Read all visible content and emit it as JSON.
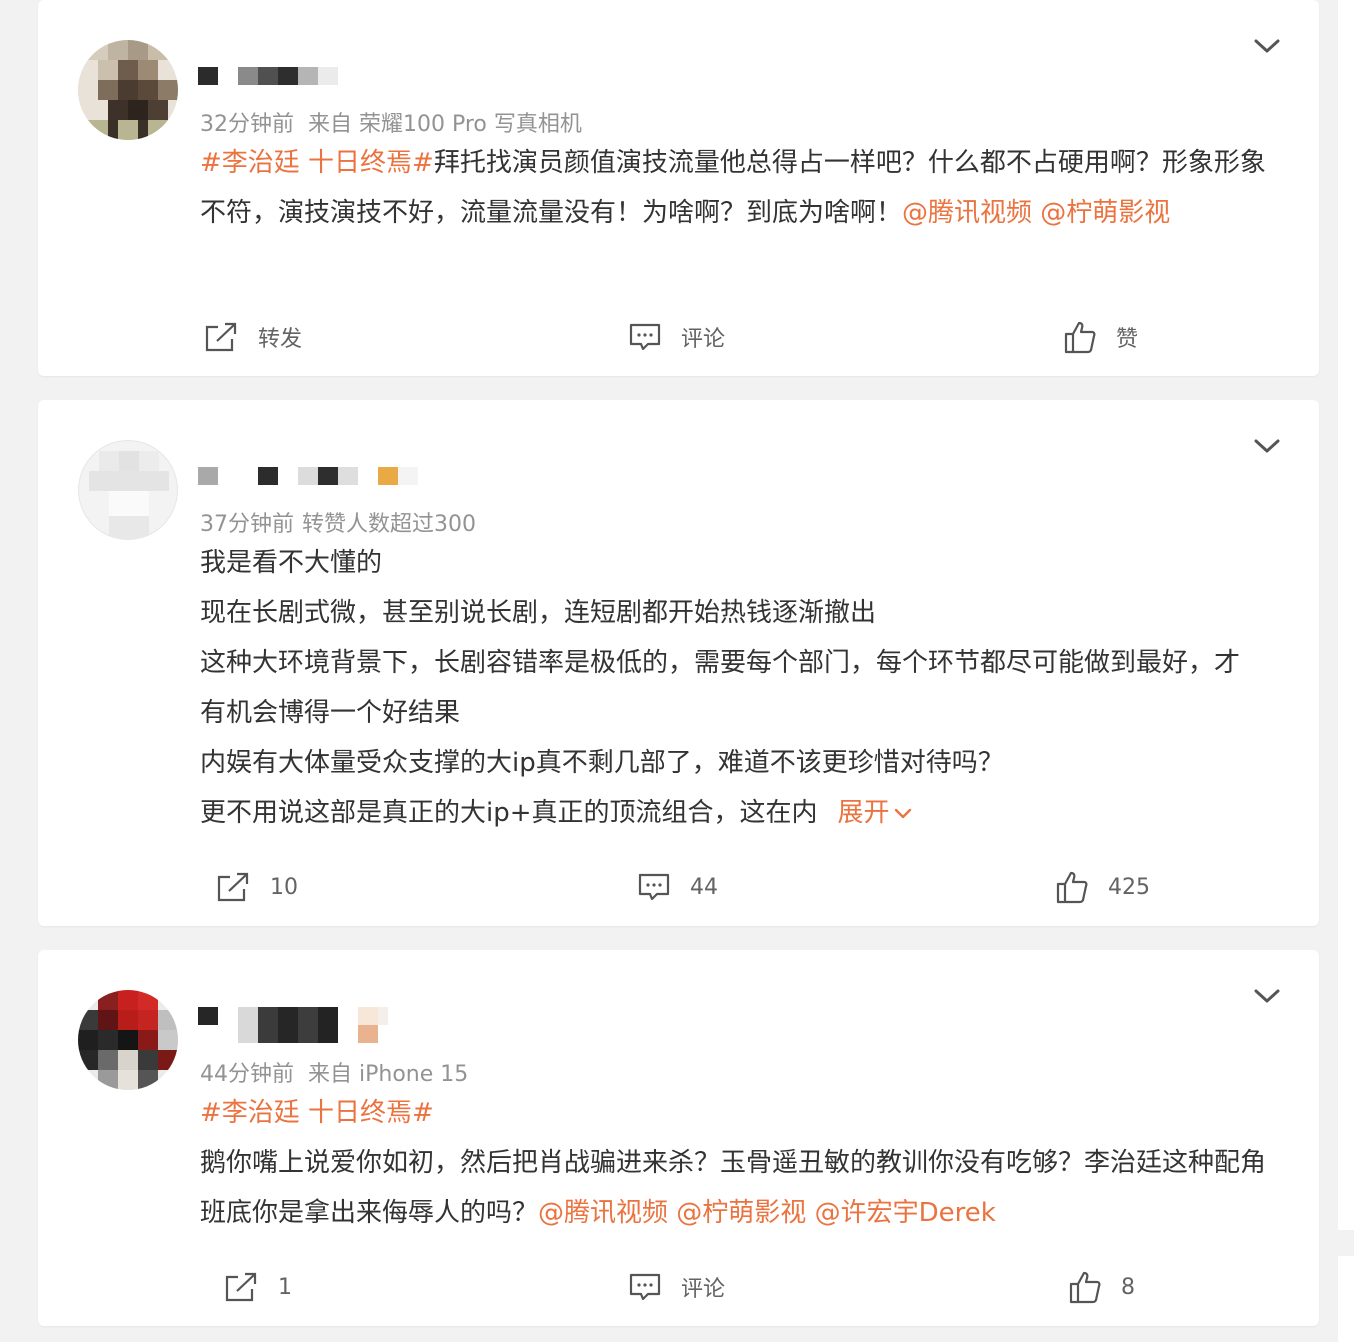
{
  "posts": [
    {
      "time": "32分钟前",
      "source": "来自 荣耀100 Pro 写真相机",
      "topic": "#李治廷 十日终焉#",
      "text": "拜托找演员颜值演技流量他总得占一样吧？什么都不占硬用啊？形象形象不符，演技演技不好，流量流量没有！为啥啊？到底为啥啊！",
      "mentions": [
        "@腾讯视频",
        "@柠萌影视"
      ],
      "repost_label": "转发",
      "comment_label": "评论",
      "like_label": "赞"
    },
    {
      "time": "37分钟前",
      "source": "转赞人数超过300",
      "lines": [
        "我是看不大懂的",
        "现在长剧式微，甚至别说长剧，连短剧都开始热钱逐渐撤出",
        "这种大环境背景下，长剧容错率是极低的，需要每个部门，每个环节都尽可能做到最好，才有机会博得一个好结果",
        "内娱有大体量受众支撑的大ip真不剩几部了，难道不该更珍惜对待吗？",
        "更不用说这部是真正的大ip+真正的顶流组合，这在内"
      ],
      "expand_label": "展开",
      "repost_label": "10",
      "comment_label": "44",
      "like_label": "425"
    },
    {
      "time": "44分钟前",
      "source": "来自 iPhone 15",
      "topic": "#李治廷 十日终焉#",
      "text": "鹅你嘴上说爱你如初，然后把肖战骗进来杀？玉骨遥丑敏的教训你没有吃够？李治廷这种配角班底你是拿出来侮辱人的吗？",
      "mentions": [
        "@腾讯视频",
        "@柠萌影视",
        "@许宏宇Derek"
      ],
      "repost_label": "1",
      "comment_label": "评论",
      "like_label": "8"
    }
  ],
  "icons": {
    "repost": "repost-icon",
    "comment": "comment-icon",
    "like": "like-icon",
    "more": "chevron-down-icon"
  },
  "colors": {
    "accent": "#eb7340",
    "meta": "#939393",
    "text": "#333333",
    "background": "#f2f2f2"
  }
}
